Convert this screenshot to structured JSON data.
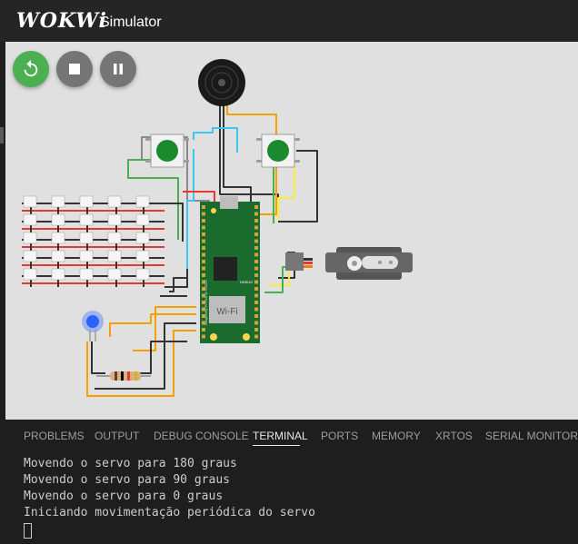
{
  "header": {
    "logo": "WOKWi",
    "title": "Simulator"
  },
  "controls": [
    {
      "name": "restart",
      "icon": "restart-icon"
    },
    {
      "name": "stop",
      "icon": "stop-icon"
    },
    {
      "name": "pause",
      "icon": "pause-icon"
    }
  ],
  "board": {
    "debug_label": "DEBUG",
    "wifi_label": "Wi-Fi",
    "board_name": "Raspberry Pi Pico W ©2022"
  },
  "panel": {
    "tabs": [
      "PROBLEMS",
      "OUTPUT",
      "DEBUG CONSOLE",
      "TERMINAL",
      "PORTS",
      "MEMORY",
      "XRTOS",
      "SERIAL MONITOR"
    ],
    "active_tab": "TERMINAL",
    "terminal_lines": [
      "Movendo o servo para 180 graus",
      "Movendo o servo para 90 graus",
      "Movendo o servo para 0 graus",
      "Iniciando movimentação periódica do servo"
    ]
  },
  "colors": {
    "accent_green": "#4caf50",
    "pico_board": "#1b6b2e",
    "led_blue": "#2962ff"
  }
}
